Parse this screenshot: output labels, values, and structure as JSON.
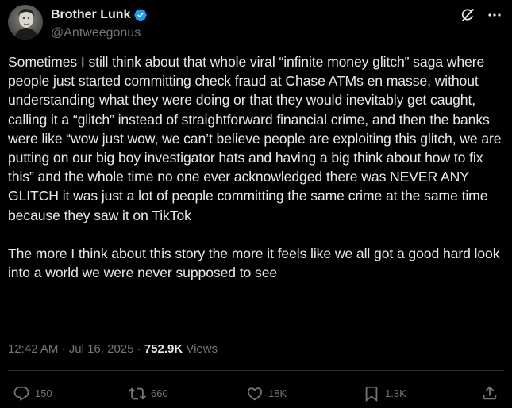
{
  "author": {
    "display_name": "Brother Lunk",
    "handle": "@Antweegonus",
    "verified": true,
    "avatar_icon": "avatar-portrait-icon"
  },
  "header_icons": [
    "grok-icon",
    "more-icon"
  ],
  "tweet": {
    "paragraphs": [
      "Sometimes I still think about that whole viral “infinite money glitch” saga where people just started committing check fraud at Chase ATMs en masse, without understanding what they were doing or that they would inevitably get caught, calling it a “glitch” instead of straightforward financial crime, and then the banks were like “wow just wow, we can’t believe people are exploiting this glitch, we are putting on our big boy investigator hats and having a big think about how to fix this” and the whole time no one ever acknowledged there was NEVER ANY GLITCH it was just a lot of people committing the same crime at the same time because they saw it on TikTok",
      "The more I think about this story the more it feels like we all got a good hard look into a world we were never supposed to see"
    ]
  },
  "meta": {
    "time": "12:42 AM",
    "separator": "·",
    "date": "Jul 16, 2025",
    "views_count": "752.9K",
    "views_label": "Views"
  },
  "actions": {
    "replies": "150",
    "reposts": "660",
    "likes": "18K",
    "bookmarks": "1.3K"
  },
  "colors": {
    "background": "#000000",
    "text": "#e7e9ea",
    "secondary": "#71767b",
    "verified": "#1d9bf0",
    "divider": "#2f3336"
  }
}
